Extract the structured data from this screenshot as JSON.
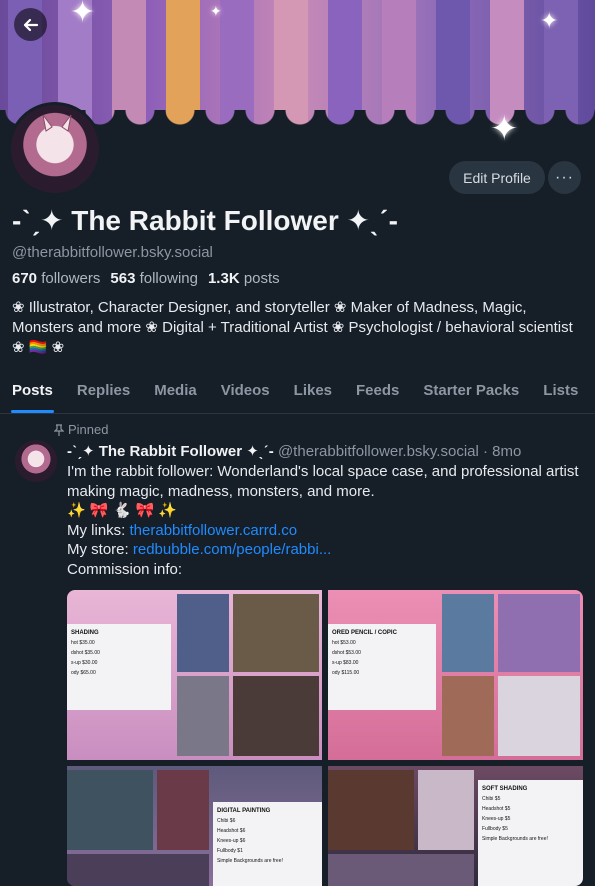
{
  "profile": {
    "display_name": "-ˋˏ✦ The Rabbit Follower ✦ˎˊ-",
    "handle": "@therabbitfollower.bsky.social",
    "followers_count": "670",
    "followers_label": "followers",
    "following_count": "563",
    "following_label": "following",
    "posts_count": "1.3K",
    "posts_label": "posts",
    "bio": "❀ Illustrator, Character Designer, and storyteller ❀ Maker of Madness, Magic, Monsters and more ❀ Digital + Traditional Artist ❀ Psychologist / behavioral scientist ❀ 🏳️‍🌈 ❀",
    "edit_button": "Edit Profile",
    "more_button": "···"
  },
  "tabs": [
    "Posts",
    "Replies",
    "Media",
    "Videos",
    "Likes",
    "Feeds",
    "Starter Packs",
    "Lists"
  ],
  "post": {
    "pinned_label": "Pinned",
    "author_name": "-ˋˏ✦ The Rabbit Follower ✦ˎˊ-",
    "author_handle": "@therabbitfollower.bsky.social",
    "separator": "·",
    "time": "8mo",
    "line1": "I'm the rabbit follower: Wonderland's local space case, and professional artist making magic, madness, monsters, and more.",
    "emoji_line": "✨ 🎀 🐇 🎀 ✨",
    "links_label": "My links:",
    "links_url": "therabbitfollower.carrd.co",
    "store_label": "My store:",
    "store_url": "redbubble.com/people/rabbi...",
    "commission_label": "Commission info:"
  },
  "images": {
    "card1_title": "SHADING",
    "card1_rows": [
      "hot $35.00",
      "dshot $35.00",
      "s-up $30.00",
      "ody $65.00"
    ],
    "card2_title": "ORED PENCIL / COPIC",
    "card2_rows": [
      "hot $53.00",
      "dshot $53.00",
      "s-up $83.00",
      "ody $115.00"
    ],
    "card3_title": "DIGITAL PAINTING",
    "card3_rows": [
      "Chibi $6",
      "Headshot $6",
      "Knees-up $6",
      "Fullbody $1"
    ],
    "card4_title": "SOFT SHADING",
    "card4_rows": [
      "Chibi $5",
      "Headshot $5",
      "Knees-up $5",
      "Fullbody $5"
    ],
    "card3_note": "Simple Backgrounds are free!",
    "card4_note": "Simple Backgrounds are free!"
  },
  "colors": {
    "background": "#161e27",
    "accent": "#208bfe",
    "muted": "#8c97a3",
    "button_bg": "#2a3542"
  }
}
